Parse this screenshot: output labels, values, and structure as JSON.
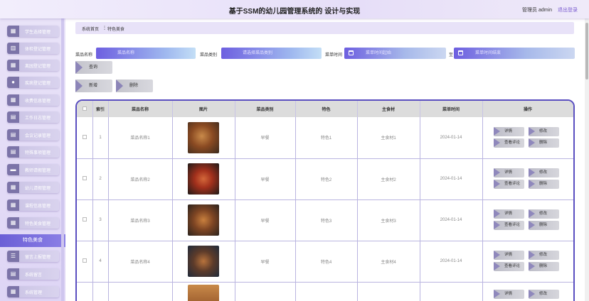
{
  "header": {
    "title": "基于SSM的幼儿园管理系统的 设计与实现",
    "user": "管理员 admin",
    "logout": "退出登录"
  },
  "sidebar": {
    "items": [
      {
        "label": "学生选择管理",
        "icon": "grid-icon"
      },
      {
        "label": "体检登记管理",
        "icon": "chart-icon"
      },
      {
        "label": "离园登记管理",
        "icon": "grid-icon"
      },
      {
        "label": "疾病登记管理",
        "icon": "pin-icon"
      },
      {
        "label": "收费信息管理",
        "icon": "grid-icon"
      },
      {
        "label": "工作日志管理",
        "icon": "doc-icon"
      },
      {
        "label": "会议记录管理",
        "icon": "doc-icon"
      },
      {
        "label": "特殊事项管理",
        "icon": "doc-icon"
      },
      {
        "label": "教师请假管理",
        "icon": "folder-icon"
      },
      {
        "label": "幼儿请假管理",
        "icon": "grid-icon"
      },
      {
        "label": "课程信息管理",
        "icon": "grid-icon"
      },
      {
        "label": "特色美食管理",
        "icon": "grid-icon"
      }
    ],
    "active": "特色美食",
    "after_items": [
      {
        "label": "留言上报管理",
        "icon": "list-icon"
      },
      {
        "label": "系统留言",
        "icon": "doc-icon"
      },
      {
        "label": "系统管理",
        "icon": "grid-icon"
      }
    ]
  },
  "breadcrumb": {
    "home": "系统首页",
    "sep": "⋮",
    "current": "特色美食"
  },
  "filters": {
    "name_label": "菜品名称",
    "name_placeholder": "菜品名称",
    "type_label": "菜品类别",
    "type_placeholder": "请选择菜品类别",
    "time_label": "菜单时间",
    "time_start_placeholder": "菜单时间起始",
    "to": "至",
    "time_end_placeholder": "菜单时间结束",
    "search_button": "查询"
  },
  "actions": {
    "add": "新增",
    "delete": "删除"
  },
  "table": {
    "columns": [
      "索引",
      "菜品名称",
      "图片",
      "菜品类别",
      "特色",
      "主食材",
      "菜单时间",
      "操作"
    ],
    "rows": [
      {
        "index": "1",
        "name": "菜品名称1",
        "type": "早餐",
        "feature": "特色1",
        "ingredient": "主食材1",
        "date": "2024-01-14"
      },
      {
        "index": "2",
        "name": "菜品名称2",
        "type": "早餐",
        "feature": "特色2",
        "ingredient": "主食材2",
        "date": "2024-01-14"
      },
      {
        "index": "3",
        "name": "菜品名称3",
        "type": "早餐",
        "feature": "特色3",
        "ingredient": "主食材3",
        "date": "2024-01-14"
      },
      {
        "index": "4",
        "name": "菜品名称4",
        "type": "早餐",
        "feature": "特色4",
        "ingredient": "主食材4",
        "date": "2024-01-14"
      }
    ],
    "ops": {
      "detail": "详情",
      "edit": "修改",
      "review": "查看评论",
      "delete": "删除"
    }
  },
  "colors": {
    "accent": "#5a4fc0",
    "active_menu": "#6b5fd6",
    "header_bg": "#ece6fa"
  }
}
